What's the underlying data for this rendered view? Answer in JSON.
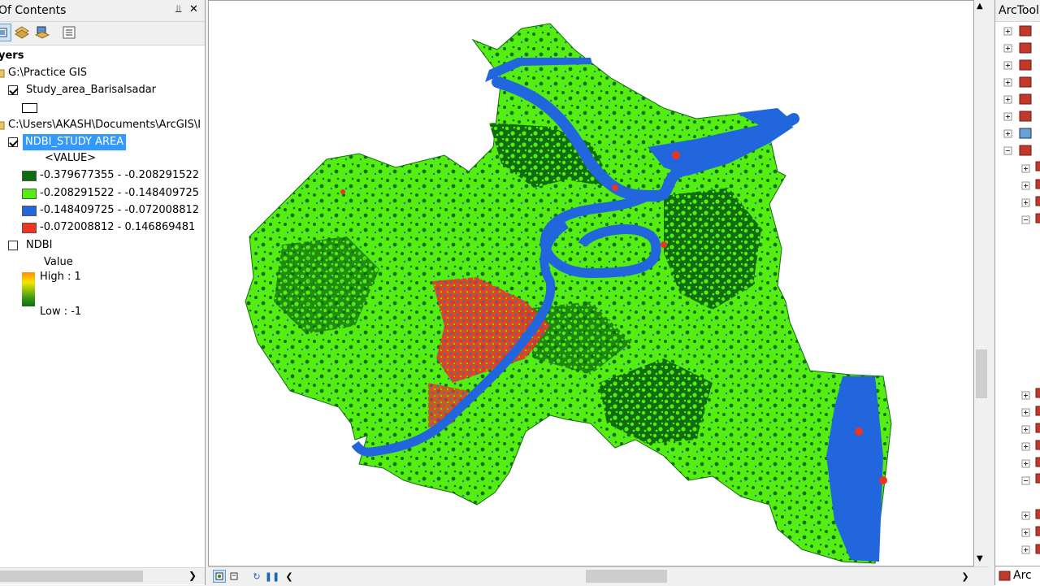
{
  "toc": {
    "title": "Of Contents",
    "pin_glyph": "Ω",
    "close_glyph": "✕",
    "section_label": "yers",
    "group1": "G:\\Practice GIS",
    "study_area_layer": "Study_area_Barisalsadar",
    "group2": "C:\\Users\\AKASH\\Documents\\ArcGIS\\I",
    "ndbi_study_layer": "NDBI_STUDY AREA",
    "value_header": "<VALUE>",
    "classes": [
      {
        "label": "-0.379677355 - -0.208291522",
        "color": "#0f6d0f"
      },
      {
        "label": "-0.208291522 - -0.148409725",
        "color": "#55ee11"
      },
      {
        "label": "-0.148409725 - -0.072008812",
        "color": "#2266dd"
      },
      {
        "label": "-0.072008812 - 0.146869481",
        "color": "#ee3322"
      }
    ],
    "ndbi_layer": "NDBI",
    "ndbi_value_label": "Value",
    "ndbi_high": "High : 1",
    "ndbi_low": "Low : -1",
    "layer_checked": {
      "study_area": true,
      "ndbi_study": true,
      "ndbi": false
    }
  },
  "toolbox": {
    "title": "ArcToolbox",
    "tab_label": "Arc"
  },
  "colors": {
    "forest": "#0f6d0f",
    "vegetation": "#55ee11",
    "water": "#2266dd",
    "builtup": "#ee3322",
    "selection": "#3399ff"
  }
}
